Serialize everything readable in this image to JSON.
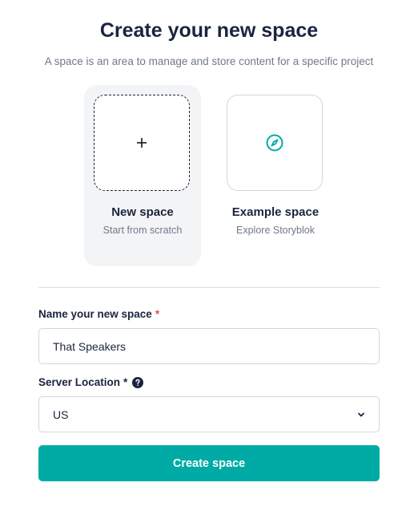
{
  "header": {
    "title": "Create your new space",
    "subtitle": "A space is an area to manage and store content for a specific project"
  },
  "options": [
    {
      "label": "New space",
      "sublabel": "Start from scratch",
      "icon": "plus-icon",
      "selected": true
    },
    {
      "label": "Example space",
      "sublabel": "Explore Storyblok",
      "icon": "compass-icon",
      "selected": false
    }
  ],
  "form": {
    "name_label": "Name your new space",
    "name_required_mark": "*",
    "name_value": "That Speakers",
    "server_label": "Server Location",
    "server_required_mark": "*",
    "server_help_icon": "question-circle-icon",
    "server_value": "US",
    "submit_label": "Create space"
  },
  "colors": {
    "accent": "#00aba5",
    "heading": "#1b243f",
    "muted": "#71788b",
    "required": "#e5484d",
    "selected_bg": "#f3f4f6"
  }
}
